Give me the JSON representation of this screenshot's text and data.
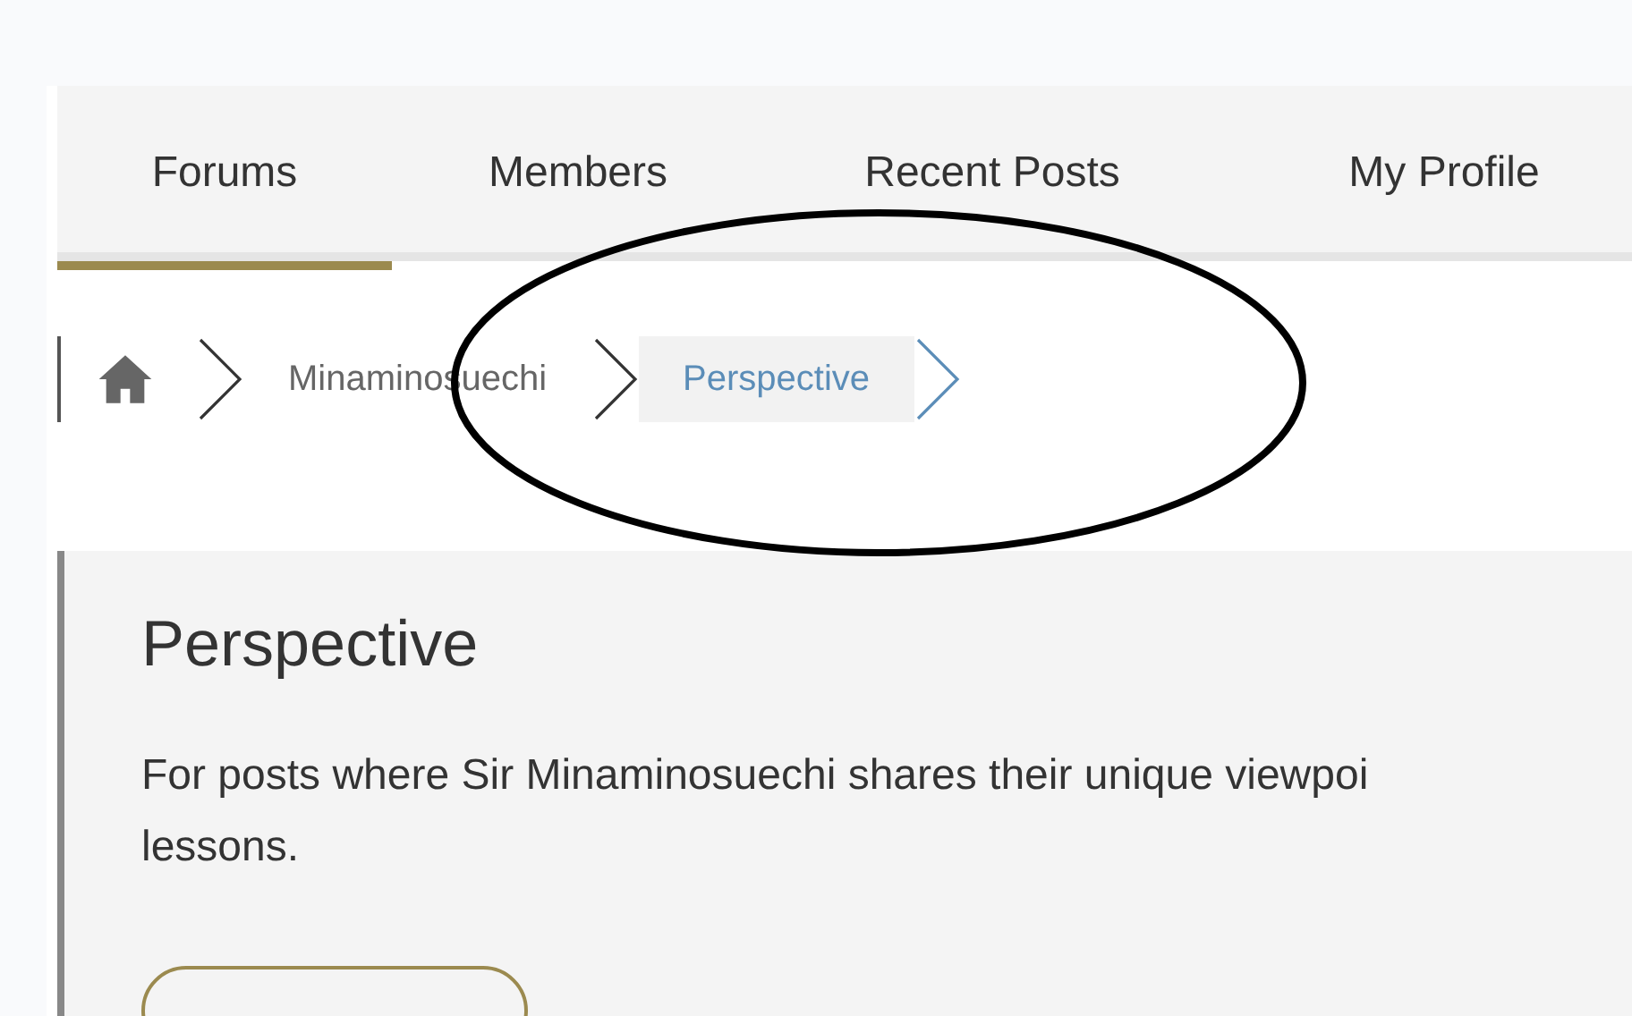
{
  "tabs": [
    {
      "label": "Forums",
      "selected": true
    },
    {
      "label": "Members",
      "selected": false
    },
    {
      "label": "Recent Posts",
      "selected": false
    },
    {
      "label": "My Profile",
      "selected": false
    }
  ],
  "breadcrumb": [
    {
      "label": "Minaminosuechi",
      "selected": false
    },
    {
      "label": "Perspective",
      "selected": true
    }
  ],
  "forum": {
    "title": "Perspective",
    "description": "For posts where Sir Minaminosuechi shares their unique viewpoi\nlessons."
  }
}
